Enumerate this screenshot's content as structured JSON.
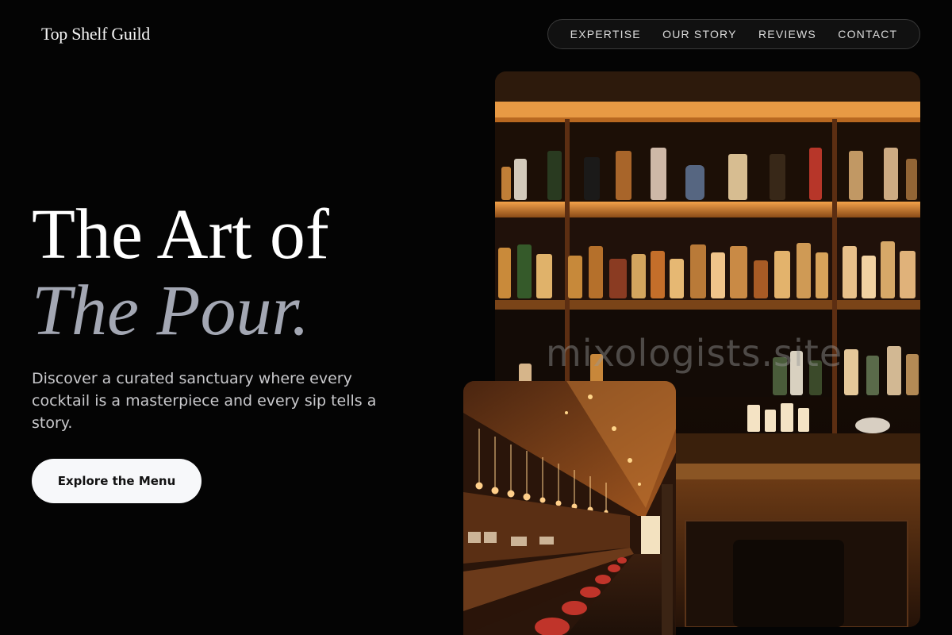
{
  "brand": {
    "name": "Top Shelf Guild"
  },
  "nav": {
    "items": [
      {
        "label": "EXPERTISE"
      },
      {
        "label": "OUR STORY"
      },
      {
        "label": "REVIEWS"
      },
      {
        "label": "CONTACT"
      }
    ]
  },
  "hero": {
    "title_line1": "The Art of",
    "title_line2": "The Pour.",
    "description": "Discover a curated sanctuary where every cocktail is a masterpiece and every sip tells a story.",
    "cta_label": "Explore the Menu"
  },
  "images": {
    "main_alt": "bar-shelves-photo",
    "secondary_alt": "bar-interior-photo",
    "watermark": "mixologists.site"
  },
  "colors": {
    "background": "#040404",
    "title_accent": "#a3a7b3",
    "cta_bg": "#f7f8fa",
    "warm_glow": "#e8902f"
  }
}
